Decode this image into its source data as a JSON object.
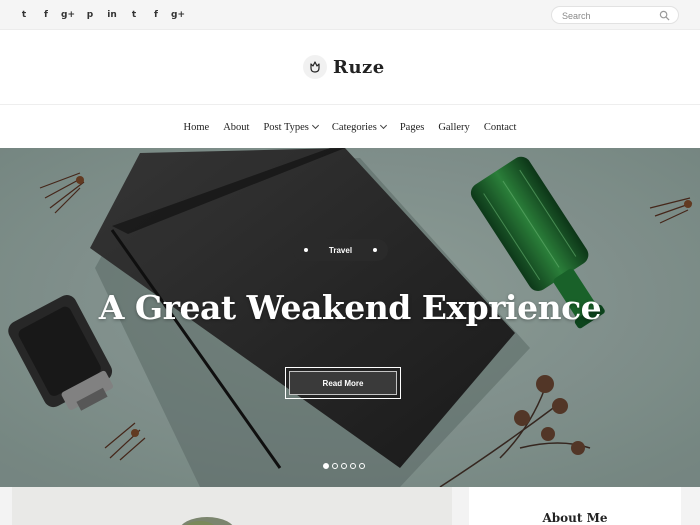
{
  "social": [
    "twitter",
    "facebook",
    "google-plus",
    "pinterest",
    "linkedin",
    "twitter",
    "facebook",
    "google-plus"
  ],
  "social_glyphs": [
    "t",
    "f",
    "g+",
    "p",
    "in",
    "t",
    "f",
    "g+"
  ],
  "search": {
    "placeholder": "Search"
  },
  "logo": {
    "text": "Ruze"
  },
  "nav": {
    "home": "Home",
    "about": "About",
    "post_types": "Post Types",
    "categories": "Categories",
    "pages": "Pages",
    "gallery": "Gallery",
    "contact": "Contact"
  },
  "hero": {
    "category": "Travel",
    "title": "A Great Weakend Exprience",
    "button": "Read More",
    "slide_count": 5,
    "active_slide": 1
  },
  "sidebar": {
    "widget_title": "About Me"
  },
  "colors": {
    "hero_bg": "#8fa09b",
    "dark": "#222222",
    "accent": "#3a3a3a"
  }
}
